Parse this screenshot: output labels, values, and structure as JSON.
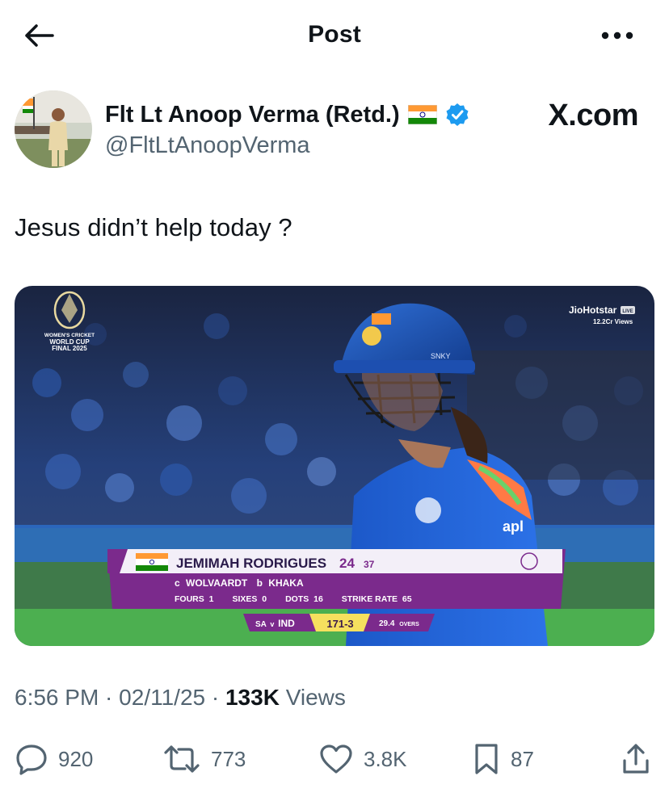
{
  "header": {
    "title": "Post",
    "back_icon": "arrow-left-icon",
    "more_icon": "more-horizontal-icon"
  },
  "author": {
    "name": "Flt Lt Anoop Verma (Retd.)",
    "handle": "@FltLtAnoopVerma",
    "flag_icon": "india-flag-icon",
    "verified_icon": "verified-badge-icon",
    "verified_color": "#1d9bf0"
  },
  "watermark": "X.com",
  "tweet": {
    "text": "Jesus didn’t help today ?"
  },
  "media": {
    "broadcast_logo": "JioHotstar",
    "live_badge": "LIVE",
    "views_overlay": "12.2Cr Views",
    "event_lines": [
      "WOMEN'S CRICKET",
      "WORLD CUP",
      "FINAL 2025"
    ],
    "helmet_text": "SNKY",
    "jersey_sponsor": "apl",
    "scorecard": {
      "batter": "JEMIMAH RODRIGUES",
      "runs": "24",
      "balls": "37",
      "dismissal_c": "c",
      "fielder": "WOLVAARDT",
      "dismissal_b": "b",
      "bowler": "KHAKA",
      "fours_label": "FOURS",
      "fours": "1",
      "sixes_label": "SIXES",
      "sixes": "0",
      "dots_label": "DOTS",
      "dots": "16",
      "sr_label": "STRIKE RATE",
      "sr": "65",
      "match_sa": "SA",
      "match_v": "v",
      "match_ind": "IND",
      "score": "171-3",
      "overs": "29.4",
      "overs_label": "OVERS"
    }
  },
  "meta": {
    "time": "6:56 PM",
    "sep1": " · ",
    "date": "02/11/25",
    "sep2": " · ",
    "views": "133K",
    "views_label": " Views"
  },
  "actions": {
    "replies": "920",
    "reposts": "773",
    "likes": "3.8K",
    "bookmarks": "87",
    "reply_icon": "reply-icon",
    "repost_icon": "repost-icon",
    "like_icon": "heart-icon",
    "bookmark_icon": "bookmark-icon",
    "share_icon": "share-icon"
  },
  "colors": {
    "text_primary": "#0f1419",
    "text_secondary": "#536471",
    "accent": "#1d9bf0",
    "scorecard_purple": "#7b2a8c",
    "score_yellow": "#f6e05e"
  }
}
